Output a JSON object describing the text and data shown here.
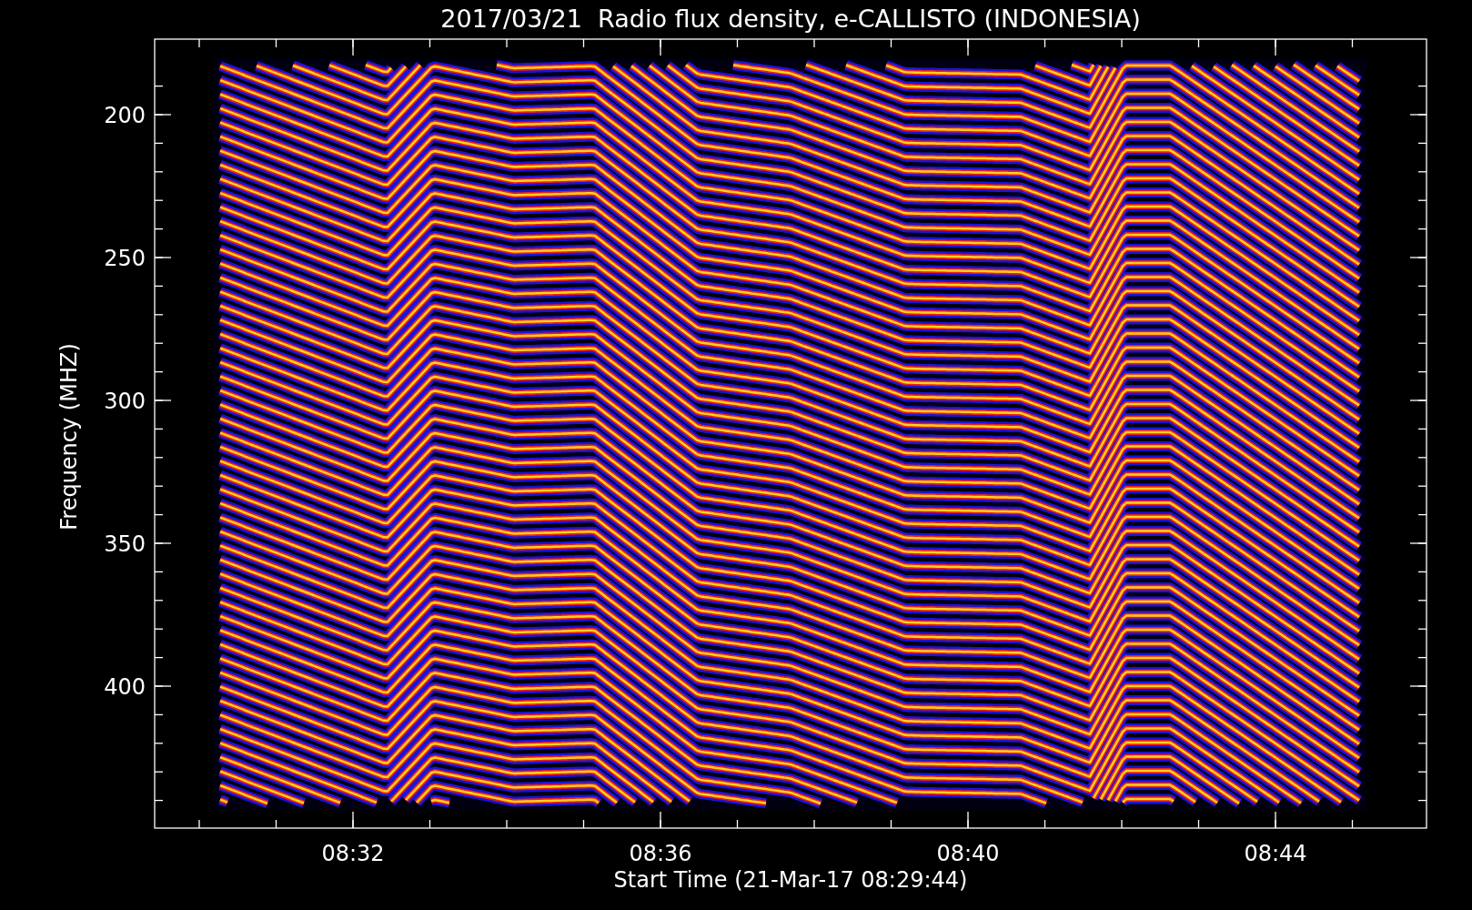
{
  "title": "2017/03/21  Radio flux density, e-CALLISTO (INDONESIA)",
  "y_axis": {
    "label": "Frequency (MHZ)",
    "ticks": [
      "200",
      "250",
      "300",
      "350",
      "400"
    ]
  },
  "x_axis": {
    "label": "Start Time (21-Mar-17 08:29:44)",
    "ticks": [
      "08:32",
      "08:36",
      "08:40",
      "08:44"
    ]
  }
}
